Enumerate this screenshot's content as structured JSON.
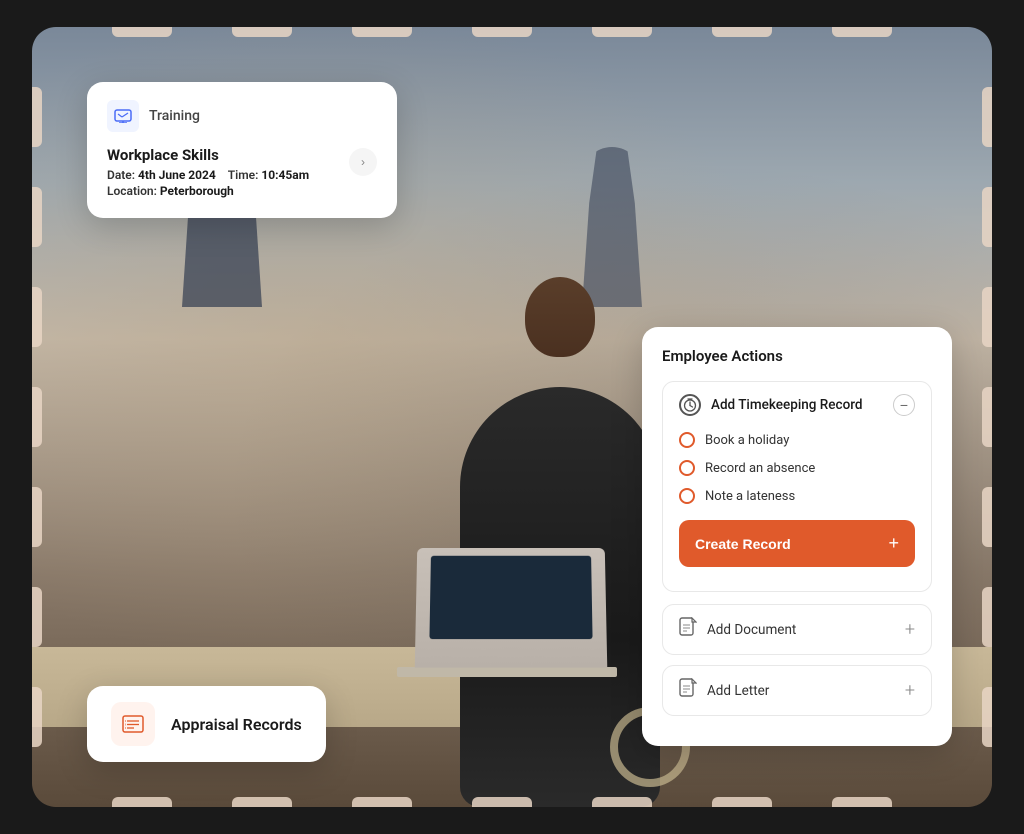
{
  "training_card": {
    "icon_label": "training-icon",
    "header_text": "Training",
    "title": "Workplace Skills",
    "date_label": "Date:",
    "date_value": "4th June 2024",
    "time_label": "Time:",
    "time_value": "10:45am",
    "location_label": "Location:",
    "location_value": "Peterborough"
  },
  "employee_actions": {
    "title": "Employee Actions",
    "timekeeping_label": "Add Timekeeping Record",
    "minus_label": "−",
    "sub_options": [
      {
        "label": "Book a holiday"
      },
      {
        "label": "Record an absence"
      },
      {
        "label": "Note a lateness"
      }
    ],
    "create_record_label": "Create Record",
    "create_plus": "+",
    "add_document_label": "Add Document",
    "add_document_plus": "+",
    "add_letter_label": "Add Letter",
    "add_letter_plus": "+"
  },
  "appraisal_card": {
    "label": "Appraisal Records"
  },
  "colors": {
    "orange": "#e05a2b",
    "light_orange_bg": "#fff3ee",
    "border": "#e8e8e8"
  }
}
